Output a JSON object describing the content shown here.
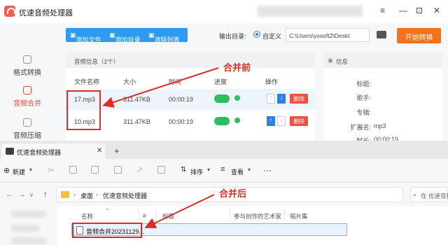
{
  "app": {
    "title": "优速音频处理器",
    "window_controls": [
      "≡",
      "—",
      "⊡",
      "✕"
    ],
    "sidebar": [
      {
        "label": "格式转换",
        "active": false
      },
      {
        "label": "音频合并",
        "active": true
      },
      {
        "label": "音频压缩",
        "active": false
      }
    ],
    "toolbar": {
      "add_file": "添加文件",
      "add_dir": "添加目录",
      "clear_list": "清除列表",
      "output_label": "输出目录:",
      "custom_label": "自定义",
      "output_path": "C:\\Users\\yssoft2\\Deskt",
      "more": "...",
      "start": "开始转换"
    },
    "list": {
      "title": "音频信息（2个）",
      "columns": [
        "文件名称",
        "大小",
        "时间",
        "进度",
        "操作"
      ],
      "rows": [
        {
          "name": "17.mp3",
          "size": "311.47KB",
          "time": "00:00:19",
          "delete": "删除"
        },
        {
          "name": "10.mp3",
          "size": "311.47KB",
          "time": "00:00:19",
          "delete": "删除"
        }
      ]
    },
    "info": {
      "title": "信息",
      "fields": [
        {
          "label": "标题:",
          "value": ""
        },
        {
          "label": "歌手:",
          "value": ""
        },
        {
          "label": "专辑:",
          "value": ""
        },
        {
          "label": "扩展名:",
          "value": "mp3"
        },
        {
          "label": "时长:",
          "value": "00:00:19"
        }
      ]
    }
  },
  "annotations": {
    "before": "合并前",
    "after": "合并后",
    "color": "#e02b2b"
  },
  "explorer": {
    "tab_title": "优速音频处理器",
    "tab_close": "✕",
    "new_tab": "+",
    "commands": {
      "new": "新建",
      "sort": "排序",
      "view": "查看",
      "more": "···"
    },
    "nav": {
      "back": "←",
      "forward": "→",
      "up": "↑"
    },
    "breadcrumb": [
      "桌面",
      "优速音频处理器"
    ],
    "search_placeholder": "在 优速音频处理器",
    "columns": [
      "名称",
      "#",
      "标题",
      "参与创作的艺术家",
      "唱片集"
    ],
    "file_name": "音频合并20231129..."
  },
  "colors": {
    "accent_blue": "#2e9bf0",
    "start_orange": "#f7711b",
    "active_red": "#e54a3a",
    "delete_red": "#f04e3e",
    "toggle_green": "#2bbf5f"
  }
}
